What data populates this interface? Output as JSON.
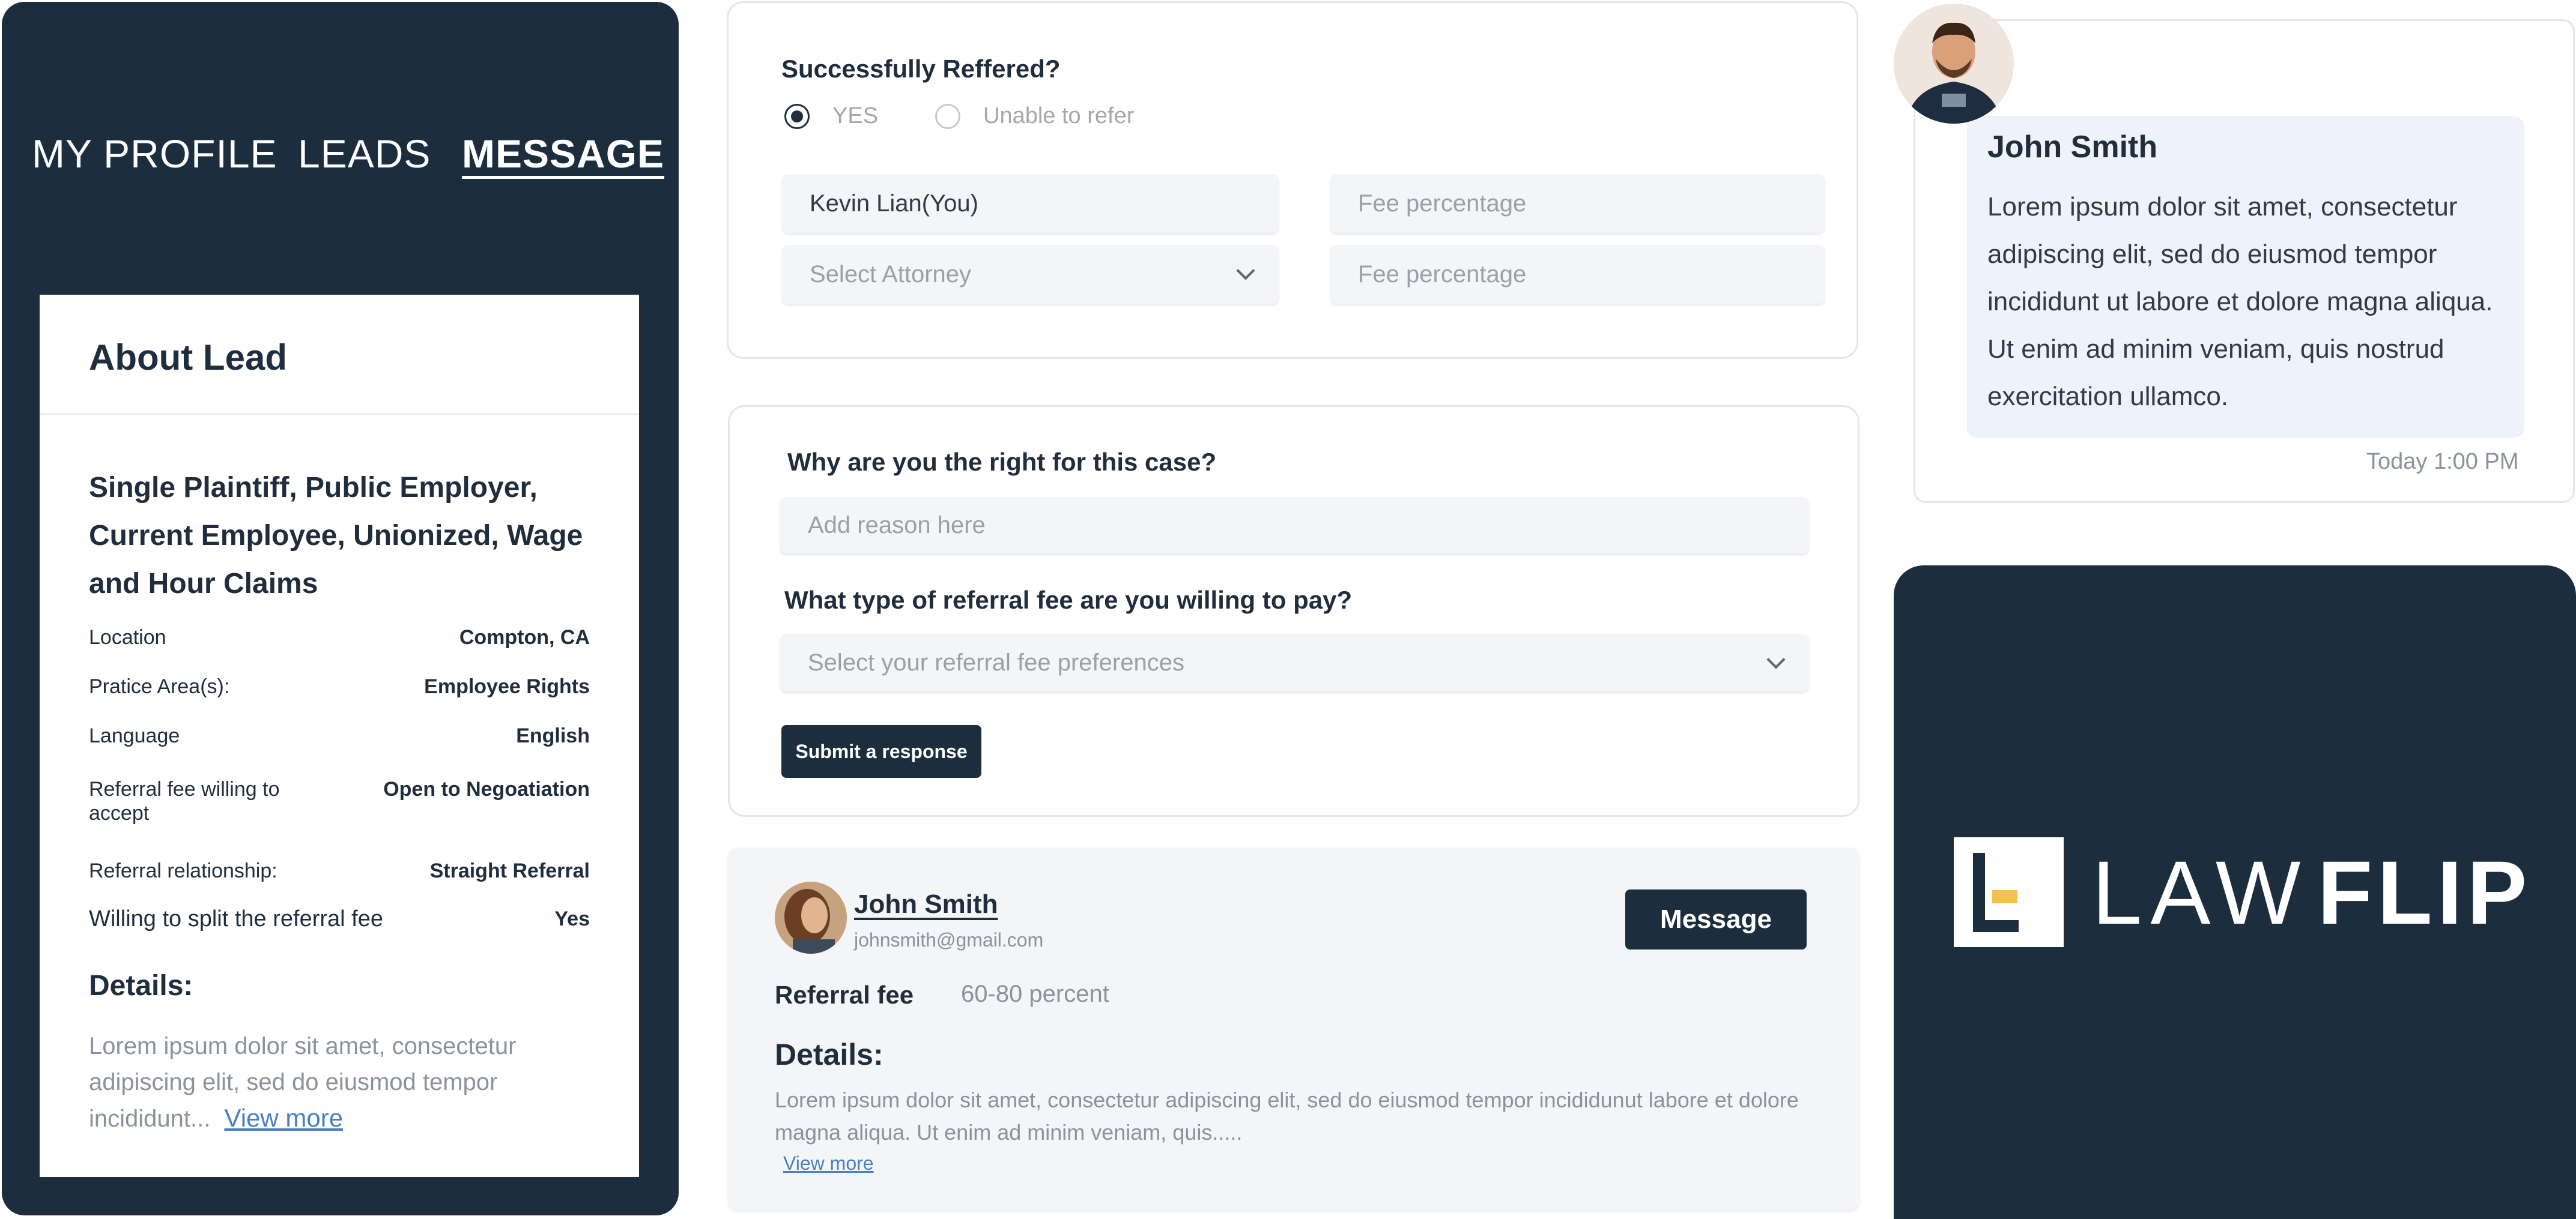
{
  "profile_panel": {
    "tabs": [
      {
        "label": "MY PROFILE",
        "active": false
      },
      {
        "label": "LEADS",
        "active": false
      },
      {
        "label": "MESSAGE",
        "active": true
      }
    ],
    "about_lead": {
      "title": "About Lead",
      "lead_type": "Single Plaintiff, Public Employer, Current Employee, Unionized, Wage and Hour Claims",
      "rows": [
        {
          "label": "Location",
          "value": "Compton, CA"
        },
        {
          "label": "Pratice Area(s):",
          "value": "Employee Rights"
        },
        {
          "label": "Language",
          "value": "English"
        },
        {
          "label": "Referral fee willing to accept",
          "value": "Open to Negoatiation"
        },
        {
          "label": "Referral relationship:",
          "value": "Straight Referral"
        },
        {
          "label": "Willing to split the referral fee",
          "value": "Yes"
        }
      ],
      "details_heading": "Details:",
      "details_text": "Lorem ipsum dolor sit amet, consectetur adipiscing elit, sed do eiusmod tempor incididunt...",
      "view_more": "View more"
    }
  },
  "referred_form": {
    "question": "Successfully Reffered?",
    "options": [
      {
        "label": "YES",
        "checked": true
      },
      {
        "label": "Unable to refer",
        "checked": false
      }
    ],
    "attorney_value": "Kevin Lian(You)",
    "attorney_select_placeholder": "Select Attorney",
    "fee_placeholder_1": "Fee percentage",
    "fee_placeholder_2": "Fee percentage"
  },
  "response_form": {
    "q1": "Why are you the right for this case?",
    "q1_placeholder": "Add reason here",
    "q2": "What type of referral fee are you willing to pay?",
    "q2_placeholder": "Select your referral fee preferences",
    "submit_label": "Submit a response"
  },
  "attorney_card": {
    "name": "John Smith",
    "email": "johnsmith@gmail.com",
    "message_button": "Message",
    "fee_label": "Referral fee",
    "fee_value": "60-80 percent",
    "details_heading": "Details:",
    "details_text": "Lorem ipsum dolor sit amet, consectetur adipiscing elit, sed do eiusmod tempor incididunut labore et dolore magna aliqua. Ut enim ad minim veniam, quis.....",
    "view_more": "View more"
  },
  "chat": {
    "sender": "John Smith",
    "message": "Lorem ipsum dolor sit amet, consectetur adipiscing elit, sed do eiusmod tempor incididunt ut labore et dolore magna aliqua. Ut enim ad minim veniam, quis nostrud exercitation ullamco.",
    "timestamp": "Today 1:00 PM"
  },
  "logo": {
    "word_light": "LAW",
    "word_bold": "FLIP",
    "colors": {
      "background": "#1c2e3e",
      "accent": "#f2c14e",
      "mark": "#ffffff"
    }
  },
  "colors": {
    "navy": "#1c2e3e",
    "link": "#4a7fc1",
    "bubble": "#eef2fa",
    "field": "#f4f5f6"
  }
}
